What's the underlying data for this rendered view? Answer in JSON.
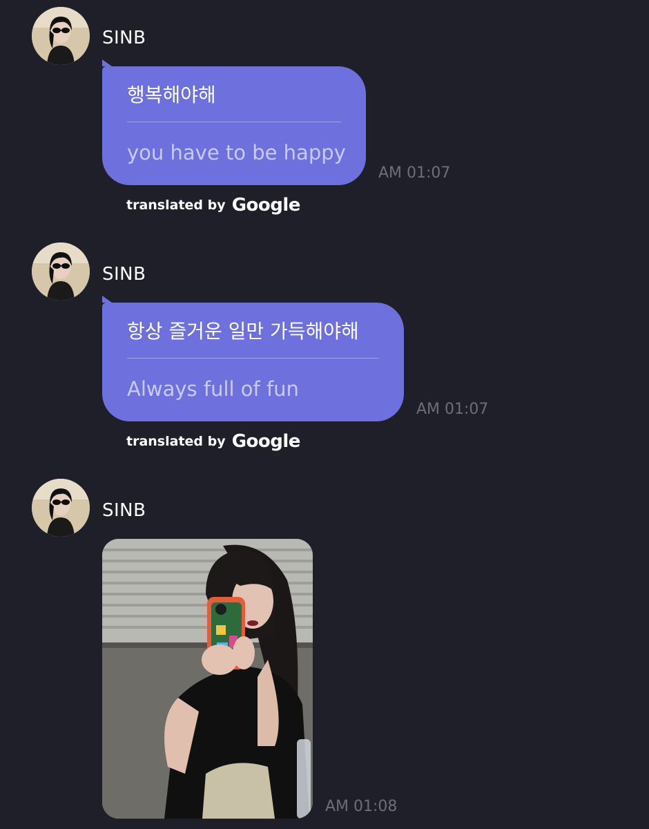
{
  "messages": [
    {
      "sender": "SINB",
      "original": "행복해야해",
      "translated": "you have to be happy",
      "time": "AM 01:07",
      "attribution_by": "translated by",
      "attribution_brand": "Google"
    },
    {
      "sender": "SINB",
      "original": "항상 즐거운 일만 가득해야해",
      "translated": "Always full of fun",
      "time": "AM 01:07",
      "attribution_by": "translated by",
      "attribution_brand": "Google"
    },
    {
      "sender": "SINB",
      "type": "image",
      "time": "AM 01:08"
    }
  ],
  "colors": {
    "background": "#1f1f29",
    "bubble": "#6e70dd",
    "timestamp": "#6e6e7a"
  }
}
